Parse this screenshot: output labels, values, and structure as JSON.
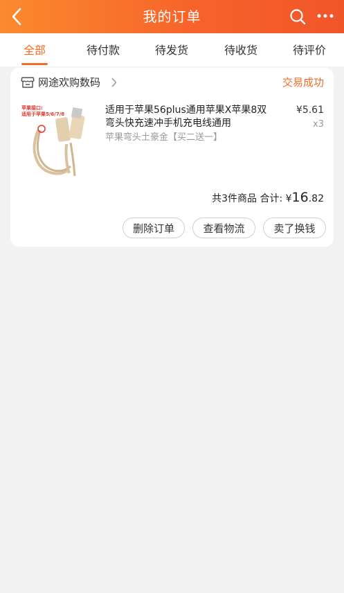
{
  "header": {
    "title": "我的订单",
    "bg_colors": [
      "#fb8a2e",
      "#f1552a"
    ],
    "icons": [
      "chevron-left-icon",
      "search-icon",
      "more-icon"
    ]
  },
  "tabs": [
    {
      "label": "全部",
      "active": true
    },
    {
      "label": "待付款",
      "active": false
    },
    {
      "label": "待发货",
      "active": false
    },
    {
      "label": "待收货",
      "active": false
    },
    {
      "label": "待评价",
      "active": false
    }
  ],
  "accent_color": "#f56b24",
  "order": {
    "shop_name": "网途欢购数码",
    "status": "交易成功",
    "item": {
      "image_text_line1": "苹果接口:",
      "image_text_line2": "适用于苹果5/6/7/8",
      "title": "适用于苹果56plus通用苹果X苹果8双弯头快充速冲手机充电线通用",
      "sku": "苹果弯头土豪金【买二送一】",
      "price": "¥5.61",
      "quantity": "x3"
    },
    "summary": {
      "count_text": "共3件商品",
      "total_label": "合计:",
      "currency": "¥",
      "total_int": "16",
      "total_dec": ".82"
    },
    "actions": [
      "删除订单",
      "查看物流",
      "卖了换钱"
    ]
  }
}
